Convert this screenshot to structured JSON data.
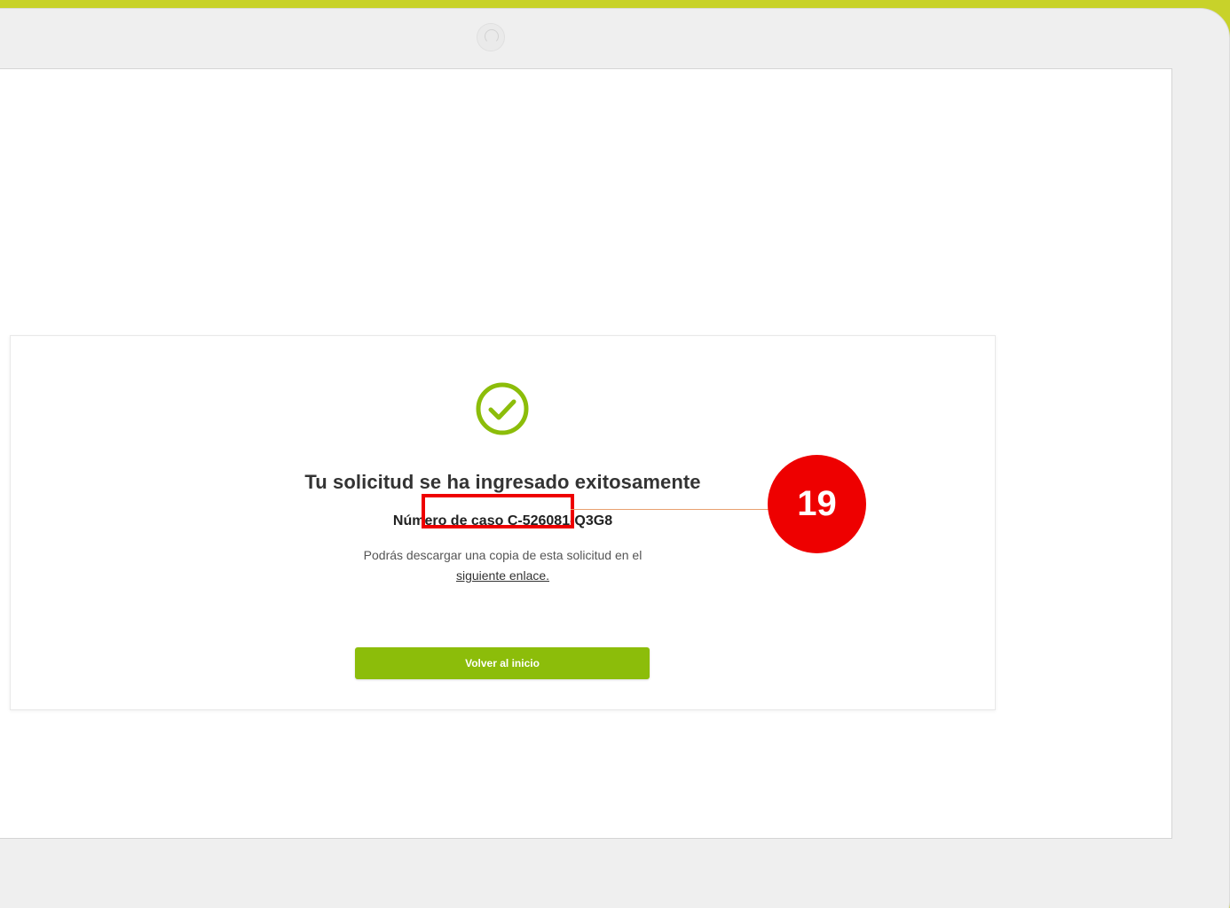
{
  "confirmation": {
    "title": "Tu solicitud se ha ingresado exitosamente",
    "case_number": "Número de caso C-526081-Q3G8",
    "download_text": "Podrás descargar una copia de esta solicitud en el",
    "download_link": "siguiente enlace.",
    "home_button": "Volver al inicio"
  },
  "annotation": {
    "step_number": "19"
  },
  "colors": {
    "brand_green": "#8cbd0a",
    "check_green": "#8cbd0a",
    "highlight_red": "#ee0000",
    "frame_accent": "#c8d22a"
  },
  "icons": {
    "success": "check-circle-icon"
  }
}
